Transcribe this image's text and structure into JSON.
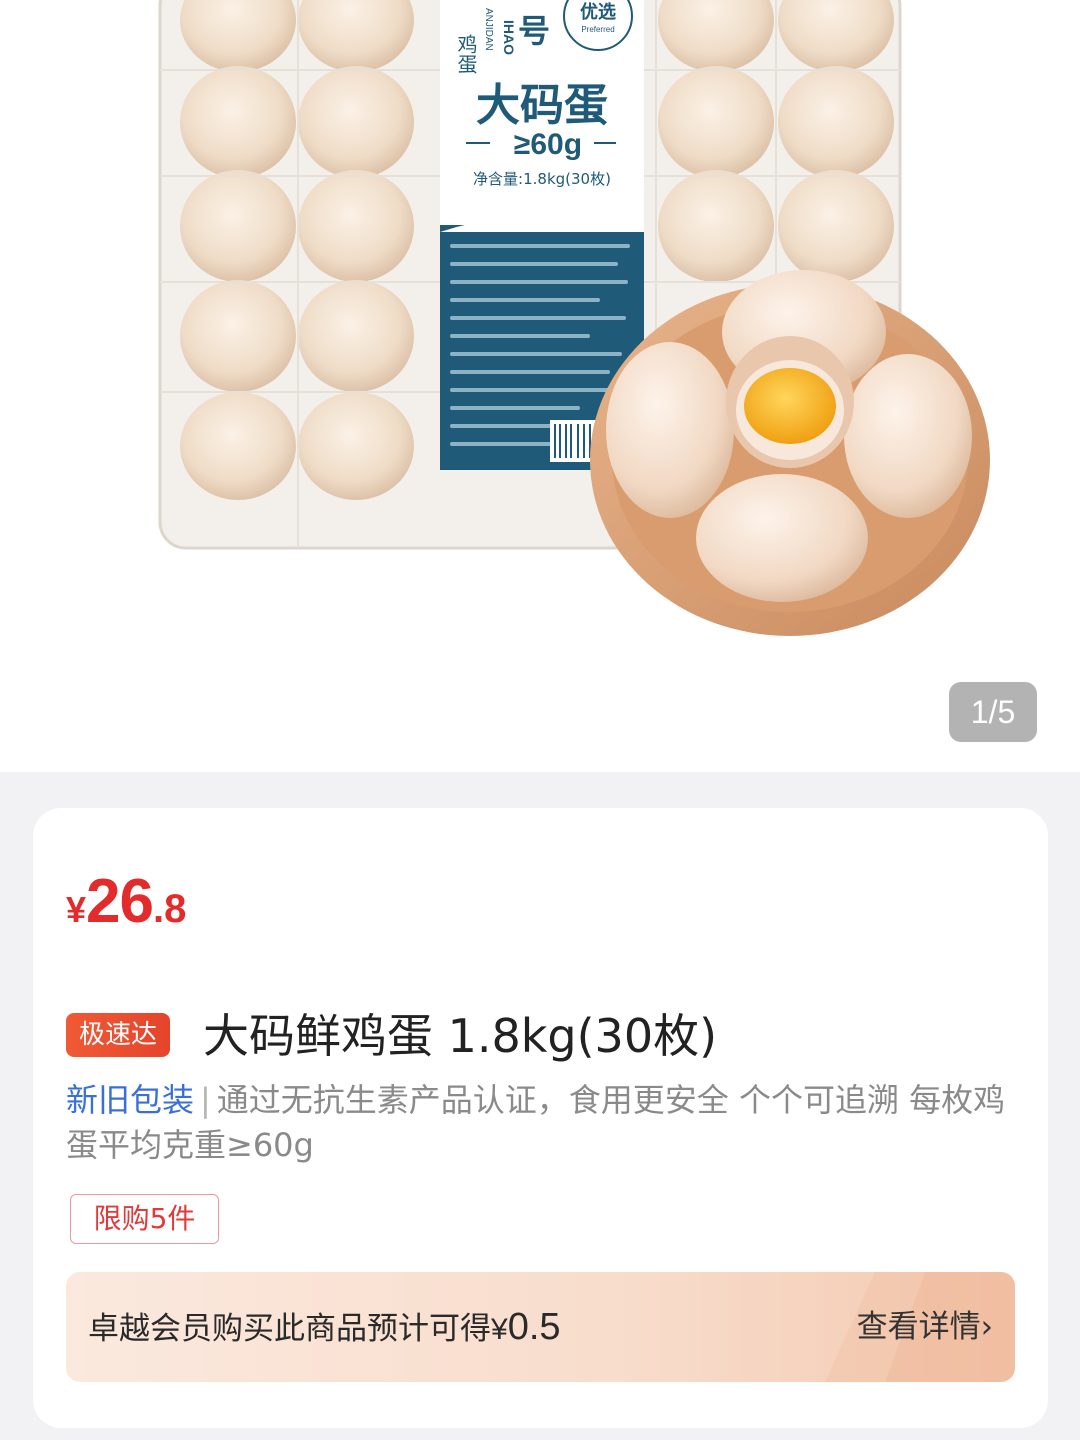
{
  "gallery": {
    "counter": "1/5",
    "package_label": {
      "brand_vertical": "鸡蛋",
      "brand_romanized": "IHAO",
      "brand_sub": "ANJIDAN",
      "brand_mark": "号",
      "seal": "优选",
      "seal_en": "Preferred",
      "product_name": "大码蛋",
      "weight_claim": "≥60g",
      "net_content": "净含量:1.8kg(30枚)"
    }
  },
  "product": {
    "price": {
      "currency": "¥",
      "integer": "26",
      "decimal": ".8"
    },
    "badge": "极速达",
    "title": "大码鲜鸡蛋 1.8kg(30枚)",
    "description": {
      "tag": "新旧包装",
      "separator": "|",
      "text": "通过无抗生素产品认证，食用更安全 个个可追溯 每枚鸡蛋平均克重≥60g"
    },
    "limit": "限购5件",
    "member": {
      "text": "卓越会员购买此商品预计可得",
      "currency": "¥",
      "amount": "0.5",
      "link": "查看详情",
      "chevron": "›"
    }
  },
  "colors": {
    "price_red": "#e32b2b",
    "tag_blue": "#3a6fd8",
    "badge_orange": "#ec4f2f",
    "label_teal": "#1f5a78"
  }
}
